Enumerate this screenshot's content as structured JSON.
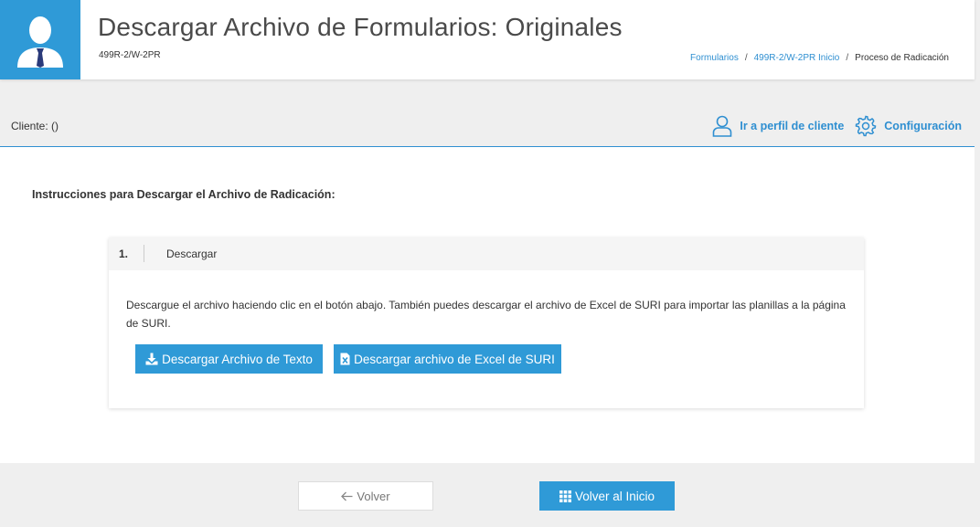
{
  "header": {
    "title": "Descargar Archivo de Formularios: Originales",
    "subtitle": "499R-2/W-2PR",
    "breadcrumb": {
      "item1": "Formularios",
      "item2": "499R-2/W-2PR Inicio",
      "current": "Proceso de Radicación",
      "separator": "/"
    }
  },
  "client_bar": {
    "client_label": "Cliente: ()",
    "profile_link": "Ir a perfil de cliente",
    "settings_link": "Configuración",
    "profile_icon": "user-outline-icon",
    "settings_icon": "gear-icon"
  },
  "main": {
    "instructions_title": "Instrucciones para Descargar el Archivo de Radicación:",
    "step": {
      "number": "1.",
      "name": "Descargar",
      "description": "Descargue el archivo haciendo clic en el botón abajo. También puedes descargar el archivo de Excel de SURI para importar las planillas a la página de SURI.",
      "download_text_button": "Descargar Archivo de Texto",
      "download_excel_button": "Descargar archivo de Excel de SURI"
    }
  },
  "footer": {
    "back_button": "Volver",
    "home_button": "Volver al Inicio"
  },
  "colors": {
    "accent": "#2f9ad7",
    "link": "#2f8fd1",
    "background": "#efefef"
  }
}
